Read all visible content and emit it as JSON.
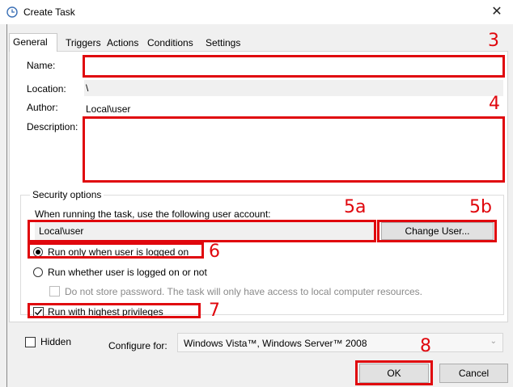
{
  "window": {
    "title": "Create Task",
    "close_glyph": "✕"
  },
  "tabs": [
    {
      "label": "General",
      "active": true
    },
    {
      "label": "Triggers",
      "active": false
    },
    {
      "label": "Actions",
      "active": false
    },
    {
      "label": "Conditions",
      "active": false
    },
    {
      "label": "Settings",
      "active": false
    }
  ],
  "general": {
    "name_label": "Name:",
    "name_value": "",
    "location_label": "Location:",
    "location_value": "\\",
    "author_label": "Author:",
    "author_value": "Local\\user",
    "description_label": "Description:",
    "description_value": ""
  },
  "security": {
    "group_label": "Security options",
    "account_prompt": "When running the task, use the following user account:",
    "account_value": "Local\\user",
    "change_user_label": "Change User...",
    "radio_logged_on": "Run only when user is logged on",
    "radio_logged_on_selected": true,
    "radio_whether": "Run whether user is logged on or not",
    "no_store_password": "Do not store password.  The task will only have access to local computer resources.",
    "highest_privileges": "Run with highest privileges",
    "highest_privileges_checked": true
  },
  "footer": {
    "hidden_label": "Hidden",
    "hidden_checked": false,
    "configure_label": "Configure for:",
    "configure_value": "Windows Vista™, Windows Server™ 2008",
    "ok_label": "OK",
    "cancel_label": "Cancel"
  },
  "annotations": {
    "n3": "3",
    "n4": "4",
    "n5a": "5a",
    "n5b": "5b",
    "n6": "6",
    "n7": "7",
    "n8": "8",
    "color": "#e0070d"
  }
}
